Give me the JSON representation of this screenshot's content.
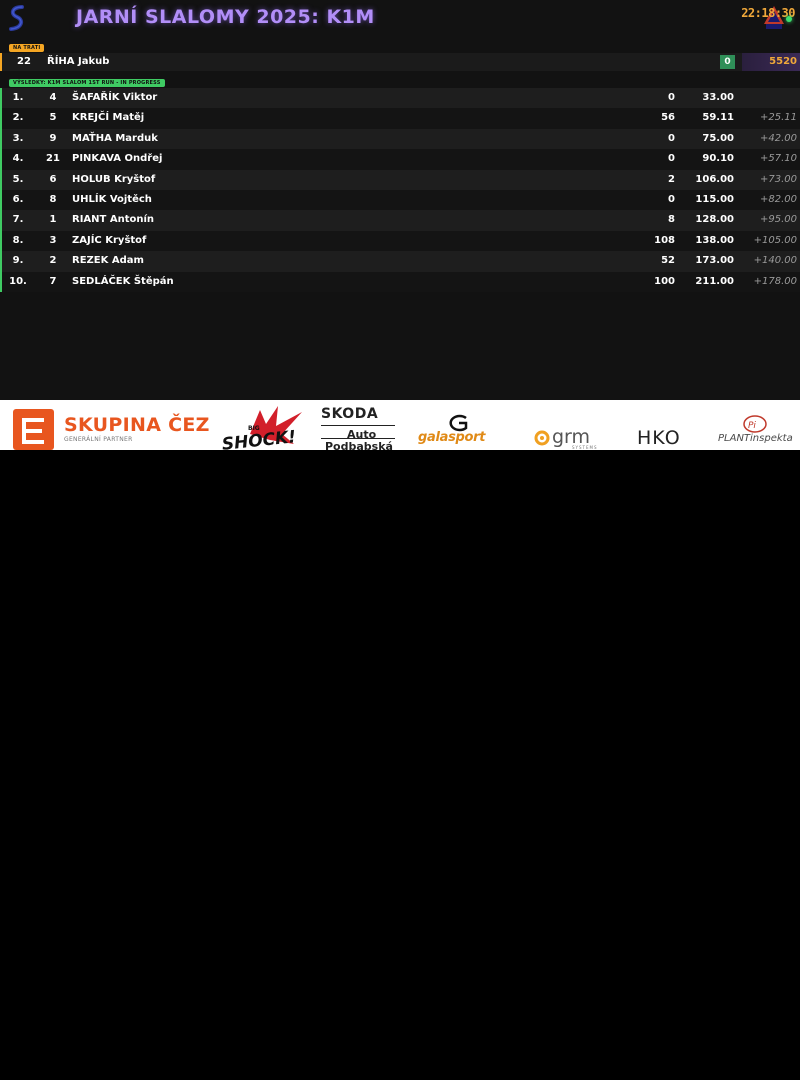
{
  "header": {
    "title": "JARNÍ SLALOMY 2025: K1M",
    "clock": "22:18:30"
  },
  "on_course": {
    "tag": "NA TRATI",
    "bib": "22",
    "name": "ŘÍHA Jakub",
    "penalty": "0",
    "time": "5520"
  },
  "results_tag": "VÝSLEDKY: K1M SLALOM 1ST RUN - IN PROGRESS",
  "results": [
    {
      "rank": "1.",
      "bib": "4",
      "name": "ŠAFAŘÍK Viktor",
      "penalty": "0",
      "time": "33.00",
      "diff": ""
    },
    {
      "rank": "2.",
      "bib": "5",
      "name": "KREJČÍ Matěj",
      "penalty": "56",
      "time": "59.11",
      "diff": "+25.11"
    },
    {
      "rank": "3.",
      "bib": "9",
      "name": "MAŤHA Marduk",
      "penalty": "0",
      "time": "75.00",
      "diff": "+42.00"
    },
    {
      "rank": "4.",
      "bib": "21",
      "name": "PINKAVA Ondřej",
      "penalty": "0",
      "time": "90.10",
      "diff": "+57.10"
    },
    {
      "rank": "5.",
      "bib": "6",
      "name": "HOLUB Kryštof",
      "penalty": "2",
      "time": "106.00",
      "diff": "+73.00"
    },
    {
      "rank": "6.",
      "bib": "8",
      "name": "UHLÍK Vojtěch",
      "penalty": "0",
      "time": "115.00",
      "diff": "+82.00"
    },
    {
      "rank": "7.",
      "bib": "1",
      "name": "RIANT Antonín",
      "penalty": "8",
      "time": "128.00",
      "diff": "+95.00"
    },
    {
      "rank": "8.",
      "bib": "3",
      "name": "ZAJÍC Kryštof",
      "penalty": "108",
      "time": "138.00",
      "diff": "+105.00"
    },
    {
      "rank": "9.",
      "bib": "2",
      "name": "REZEK Adam",
      "penalty": "52",
      "time": "173.00",
      "diff": "+140.00"
    },
    {
      "rank": "10.",
      "bib": "7",
      "name": "SEDLÁČEK Štěpán",
      "penalty": "100",
      "time": "211.00",
      "diff": "+178.00"
    }
  ],
  "sponsors": {
    "cez_name": "SKUPINA ČEZ",
    "cez_sub": "GENERÁLNÍ PARTNER",
    "shock_name": "BIG SHOCK!",
    "skoda_name": "SKODA",
    "skoda_auto": "Auto",
    "skoda_place": "Podbabská",
    "gala_name": "galasport",
    "grm_name": "grm",
    "grm_sub": "SYSTEMS",
    "hko_name": "HKO",
    "plant_name": "PLANTinspekta"
  },
  "colors": {
    "accent_orange": "#f5a623",
    "accent_green": "#3fcb63",
    "title_purple": "#b28ef8",
    "cez_orange": "#e8561f"
  }
}
